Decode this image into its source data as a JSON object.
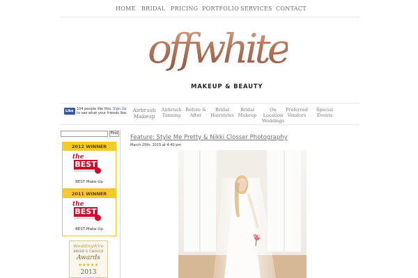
{
  "top_nav": [
    "HOME",
    "BRIDAL",
    "PRICING",
    "PORTFOLIO",
    "SERVICES",
    "CONTACT"
  ],
  "logo": {
    "script": "offwhite",
    "subtitle": "MAKEUP & BEAUTY"
  },
  "facebook": {
    "button": "Like",
    "count_text": "104 people like this.",
    "signup": "Sign Up",
    "rest": "to see what your friends like."
  },
  "categories": [
    "Airbrush\nMakeup",
    "Airbrush\nTanning",
    "Before &\nAfter",
    "Bridal\nHairstyles",
    "Bridal\nMakeup",
    "On\nLocation\nWeddings",
    "Preferred\nVendors",
    "Special\nEvents"
  ],
  "search": {
    "button": "Find",
    "placeholder": ""
  },
  "awards": [
    {
      "header": "2012 WINNER",
      "the": "the",
      "best": "BEST",
      "caption": "BEST Make-Up"
    },
    {
      "header": "2011 WINNER",
      "the": "the",
      "best": "BEST",
      "caption": "BEST Make-Up"
    }
  ],
  "wedding_wire": {
    "brand": "WeddingWire",
    "line": "BRIDE'S CHOICE",
    "awards": "Awards",
    "stars": "★★★★★",
    "year": "2013"
  },
  "post": {
    "title": "Feature: Style Me Pretty & Nikki Closser Photography",
    "meta": "March 25th, 2015 at 4:40 pm"
  },
  "colors": {
    "logo_copper": "#b97f67",
    "award_yellow": "#f4cb2e",
    "award_red": "#c8102e",
    "facebook_blue": "#3b5998"
  }
}
